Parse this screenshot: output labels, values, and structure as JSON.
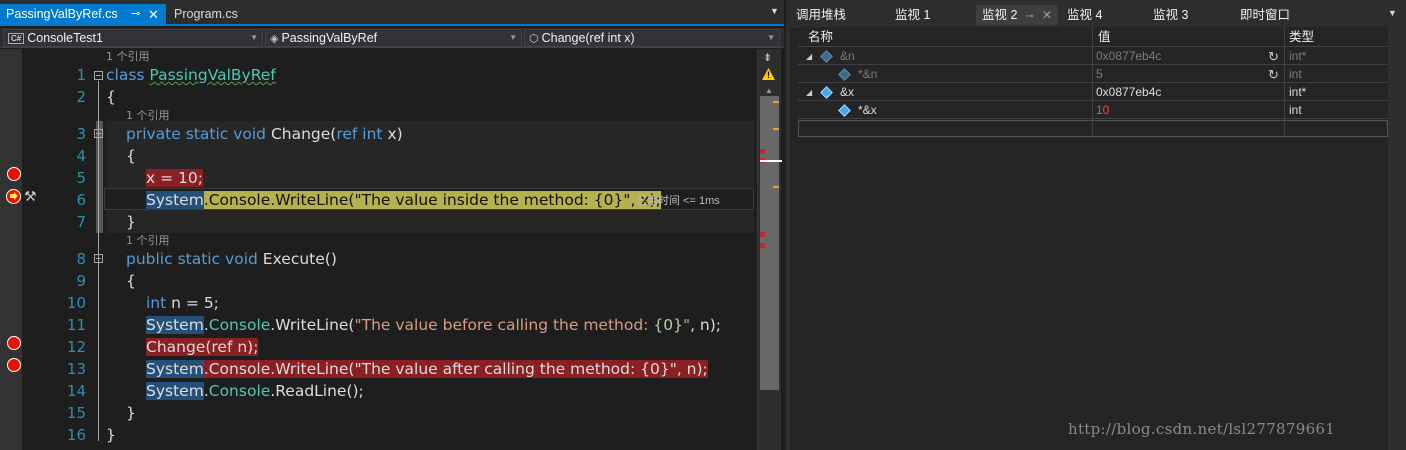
{
  "editor": {
    "tabs": [
      {
        "label": "PassingValByRef.cs",
        "active": true
      },
      {
        "label": "Program.cs",
        "active": false
      }
    ],
    "nav": {
      "project": "ConsoleTest1",
      "project_icon": "C#",
      "class": "PassingValByRef",
      "member": "Change(ref int x)"
    },
    "codelens": {
      "class_refs": "1 个引用",
      "change_refs": "1 个引用",
      "execute_refs": "1 个引用"
    },
    "line_numbers": [
      "1",
      "2",
      "3",
      "4",
      "5",
      "6",
      "7",
      "8",
      "9",
      "10",
      "11",
      "12",
      "13",
      "14",
      "15",
      "16"
    ],
    "code": {
      "l1_kw": "class",
      "l1_name": "PassingValByRef",
      "l2": "{",
      "l3_mods": "private static void",
      "l3_name": "Change(",
      "l3_ref": "ref int",
      "l3_param": "x",
      "l3_end": ")",
      "l4": "{",
      "l5": "x = 10;",
      "l6_sys": "System",
      "l6_rest": ".Console.WriteLine(",
      "l6_str": "\"The value inside the method: {0}\"",
      "l6_end": ", x);",
      "l7": "}",
      "l8_mods": "public static void",
      "l8_name": "Execute()",
      "l9": "{",
      "l10_kw": "int",
      "l10_rest": "n = 5;",
      "l11_sys": "System",
      "l11_dot": ".",
      "l11_cls": "Console",
      "l11_call": ".WriteLine(",
      "l11_str1": "\"The value before calling the method: ",
      "l11_fmt": "{0}",
      "l11_str2": "\"",
      "l11_end": ", n);",
      "l12": "Change(ref n);",
      "l13_sys": "System",
      "l13_rest": ".Console.WriteLine(",
      "l13_str": "\"The value after calling the method: {0}\"",
      "l13_end": ", n);",
      "l14_sys": "System",
      "l14_dot": ".",
      "l14_cls": "Console",
      "l14_end": ".ReadLine();",
      "l15": "}",
      "l16": "}"
    },
    "elapsed": "已用时间 <= 1ms"
  },
  "watch": {
    "tabs": [
      "调用堆栈",
      "监视 1",
      "监视 2",
      "监视 4",
      "监视 3",
      "即时窗口"
    ],
    "active_tab": "监视 2",
    "columns": {
      "name": "名称",
      "value": "值",
      "type": "类型"
    },
    "rows": [
      {
        "name": "&n",
        "value": "0x0877eb4c",
        "type": "int*"
      },
      {
        "name": "*&n",
        "value": "5",
        "type": "int"
      },
      {
        "name": "&x",
        "value": "0x0877eb4c",
        "type": "int*"
      },
      {
        "name": "*&x",
        "value": "10",
        "type": "int"
      }
    ],
    "watermark": "http://blog.csdn.net/lsl277879661"
  },
  "colors": {
    "accent": "#007acc",
    "breakpoint": "#e51400",
    "breakpoint_line": "#8a1f24",
    "current_line": "#b5b24d",
    "keyword": "#569cd6",
    "type": "#4ec9b0",
    "string": "#d69d85"
  }
}
